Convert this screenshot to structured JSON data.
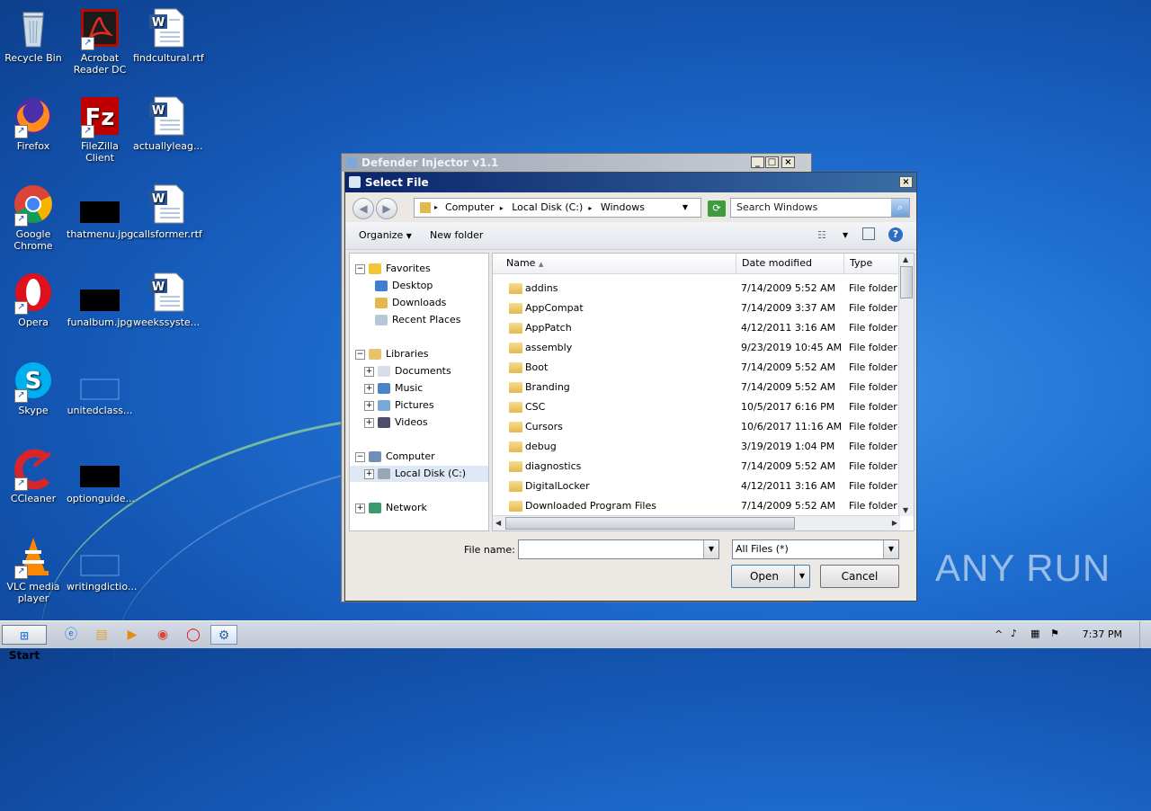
{
  "desktop": {
    "icons": [
      {
        "label": "Recycle Bin"
      },
      {
        "label": "Acrobat Reader DC"
      },
      {
        "label": "findcultural.rtf"
      },
      {
        "label": "Firefox"
      },
      {
        "label": "FileZilla Client"
      },
      {
        "label": "actuallyleag..."
      },
      {
        "label": "Google Chrome"
      },
      {
        "label": "thatmenu.jpg"
      },
      {
        "label": "callsformer.rtf"
      },
      {
        "label": "Opera"
      },
      {
        "label": "funalbum.jpg"
      },
      {
        "label": "weekssyste..."
      },
      {
        "label": "Skype"
      },
      {
        "label": "unitedclass..."
      },
      {
        "label": "CCleaner"
      },
      {
        "label": "optionguide..."
      },
      {
        "label": "VLC media player"
      },
      {
        "label": "writingdictio..."
      }
    ]
  },
  "bg_window": {
    "title": "Defender Injector v1.1"
  },
  "dialog": {
    "title": "Select File",
    "address": {
      "crumbs": [
        "Computer",
        "Local Disk (C:)",
        "Windows"
      ]
    },
    "search_placeholder": "Search Windows",
    "toolbar": {
      "organize": "Organize",
      "new_folder": "New folder"
    },
    "nav": {
      "favorites": "Favorites",
      "desktop": "Desktop",
      "downloads": "Downloads",
      "recent": "Recent Places",
      "libraries": "Libraries",
      "documents": "Documents",
      "music": "Music",
      "pictures": "Pictures",
      "videos": "Videos",
      "computer": "Computer",
      "local_disk": "Local Disk (C:)",
      "network": "Network"
    },
    "columns": {
      "name": "Name",
      "date": "Date modified",
      "type": "Type"
    },
    "rows": [
      {
        "name": "addins",
        "date": "7/14/2009 5:52 AM",
        "type": "File folder"
      },
      {
        "name": "AppCompat",
        "date": "7/14/2009 3:37 AM",
        "type": "File folder"
      },
      {
        "name": "AppPatch",
        "date": "4/12/2011 3:16 AM",
        "type": "File folder"
      },
      {
        "name": "assembly",
        "date": "9/23/2019 10:45 AM",
        "type": "File folder"
      },
      {
        "name": "Boot",
        "date": "7/14/2009 5:52 AM",
        "type": "File folder"
      },
      {
        "name": "Branding",
        "date": "7/14/2009 5:52 AM",
        "type": "File folder"
      },
      {
        "name": "CSC",
        "date": "10/5/2017 6:16 PM",
        "type": "File folder"
      },
      {
        "name": "Cursors",
        "date": "10/6/2017 11:16 AM",
        "type": "File folder"
      },
      {
        "name": "debug",
        "date": "3/19/2019 1:04 PM",
        "type": "File folder"
      },
      {
        "name": "diagnostics",
        "date": "7/14/2009 5:52 AM",
        "type": "File folder"
      },
      {
        "name": "DigitalLocker",
        "date": "4/12/2011 3:16 AM",
        "type": "File folder"
      },
      {
        "name": "Downloaded Program Files",
        "date": "7/14/2009 5:52 AM",
        "type": "File folder"
      }
    ],
    "file_name_label": "File name:",
    "file_name_value": "",
    "filter_value": "All Files (*)",
    "open_label": "Open",
    "cancel_label": "Cancel"
  },
  "taskbar": {
    "start_label": "Start",
    "clock": "7:37 PM"
  },
  "watermark": "ANY RUN"
}
